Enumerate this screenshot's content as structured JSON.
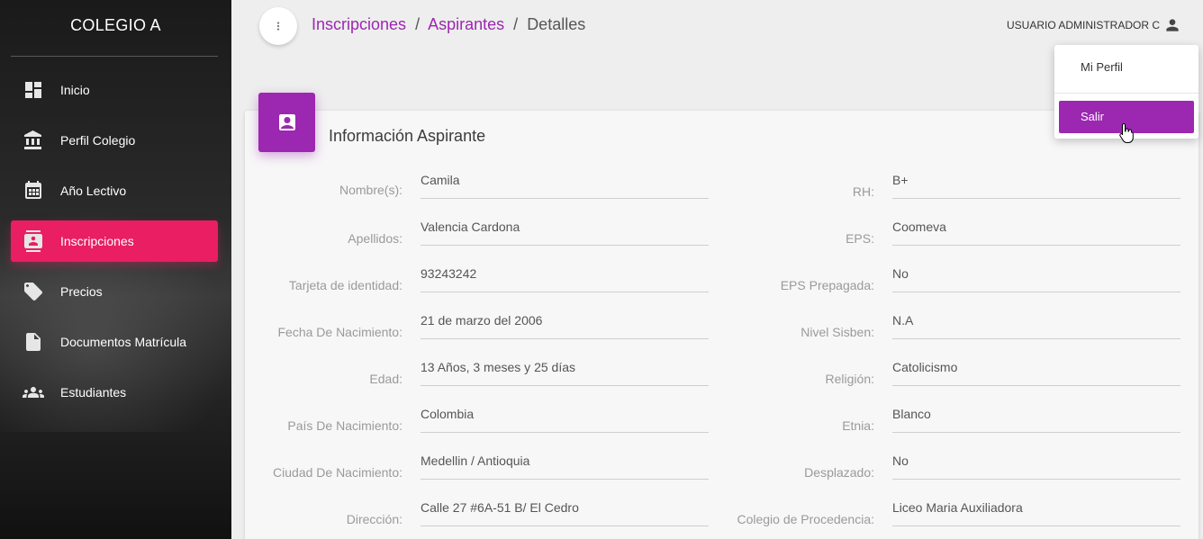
{
  "sidebar": {
    "title": "COLEGIO A",
    "items": [
      {
        "label": "Inicio",
        "icon": "dashboard-icon"
      },
      {
        "label": "Perfil Colegio",
        "icon": "bank-icon"
      },
      {
        "label": "Año Lectivo",
        "icon": "calendar-icon"
      },
      {
        "label": "Inscripciones",
        "icon": "contacts-icon",
        "active": true
      },
      {
        "label": "Precios",
        "icon": "ticket-icon"
      },
      {
        "label": "Documentos Matrícula",
        "icon": "document-icon"
      },
      {
        "label": "Estudiantes",
        "icon": "group-icon"
      }
    ]
  },
  "breadcrumb": {
    "part1": "Inscripciones",
    "sep1": "/",
    "part2": "Aspirantes",
    "sep2": "/",
    "part3": "Detalles"
  },
  "user": {
    "name": "USUARIO ADMINISTRADOR C",
    "menu": [
      "Mi Perfil",
      "Salir"
    ]
  },
  "card": {
    "title": "Información Aspirante",
    "left_fields": [
      {
        "label": "Nombre(s):",
        "value": "Camila"
      },
      {
        "label": "Apellidos:",
        "value": "Valencia Cardona"
      },
      {
        "label": "Tarjeta de identidad:",
        "value": "93243242"
      },
      {
        "label": "Fecha De Nacimiento:",
        "value": "21 de marzo del 2006"
      },
      {
        "label": "Edad:",
        "value": "13 Años, 3 meses y 25 días"
      },
      {
        "label": "País De Nacimiento:",
        "value": "Colombia"
      },
      {
        "label": "Ciudad De Nacimiento:",
        "value": "Medellin / Antioquia"
      },
      {
        "label": "Dirección:",
        "value": "Calle 27 #6A-51 B/ El Cedro"
      }
    ],
    "right_fields": [
      {
        "label": "RH:",
        "value": "B+"
      },
      {
        "label": "EPS:",
        "value": "Coomeva"
      },
      {
        "label": "EPS Prepagada:",
        "value": "No"
      },
      {
        "label": "Nivel Sisben:",
        "value": "N.A"
      },
      {
        "label": "Religión:",
        "value": "Catolicismo"
      },
      {
        "label": "Etnia:",
        "value": "Blanco"
      },
      {
        "label": "Desplazado:",
        "value": "No"
      },
      {
        "label": "Colegio de Procedencia:",
        "value": "Liceo Maria Auxiliadora"
      }
    ]
  },
  "colors": {
    "accent_purple": "#9c27b0",
    "active_pink": "#e91e63"
  }
}
